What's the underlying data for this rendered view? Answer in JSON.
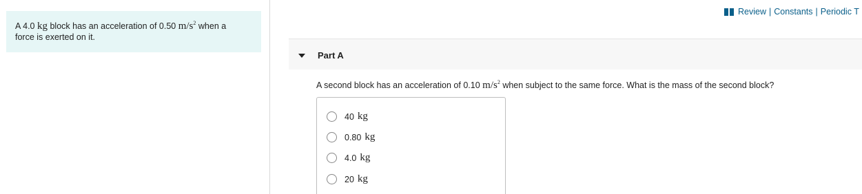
{
  "intro": {
    "part1": "A 4.0",
    "unit1": "kg",
    "part2": "block has an acceleration of 0.50",
    "unit2": "m/s",
    "unit2_exp": "2",
    "part3": "when a",
    "line2": "force is exerted on it."
  },
  "toolbar": {
    "review": "Review",
    "constants": "Constants",
    "periodic": "Periodic T",
    "separator": "|"
  },
  "part": {
    "title": "Part A"
  },
  "question": {
    "text1": "A second block has an acceleration of 0.10",
    "unit": "m/s",
    "unit_exp": "2",
    "text2": "when subject to the same force. What is the mass of the second block?"
  },
  "options": [
    {
      "value": "40",
      "unit": "kg"
    },
    {
      "value": "0.80",
      "unit": "kg"
    },
    {
      "value": "4.0",
      "unit": "kg"
    },
    {
      "value": "20",
      "unit": "kg"
    }
  ],
  "colors": {
    "accent_link": "#0a5f8a",
    "intro_bg": "#e6f6f6"
  }
}
